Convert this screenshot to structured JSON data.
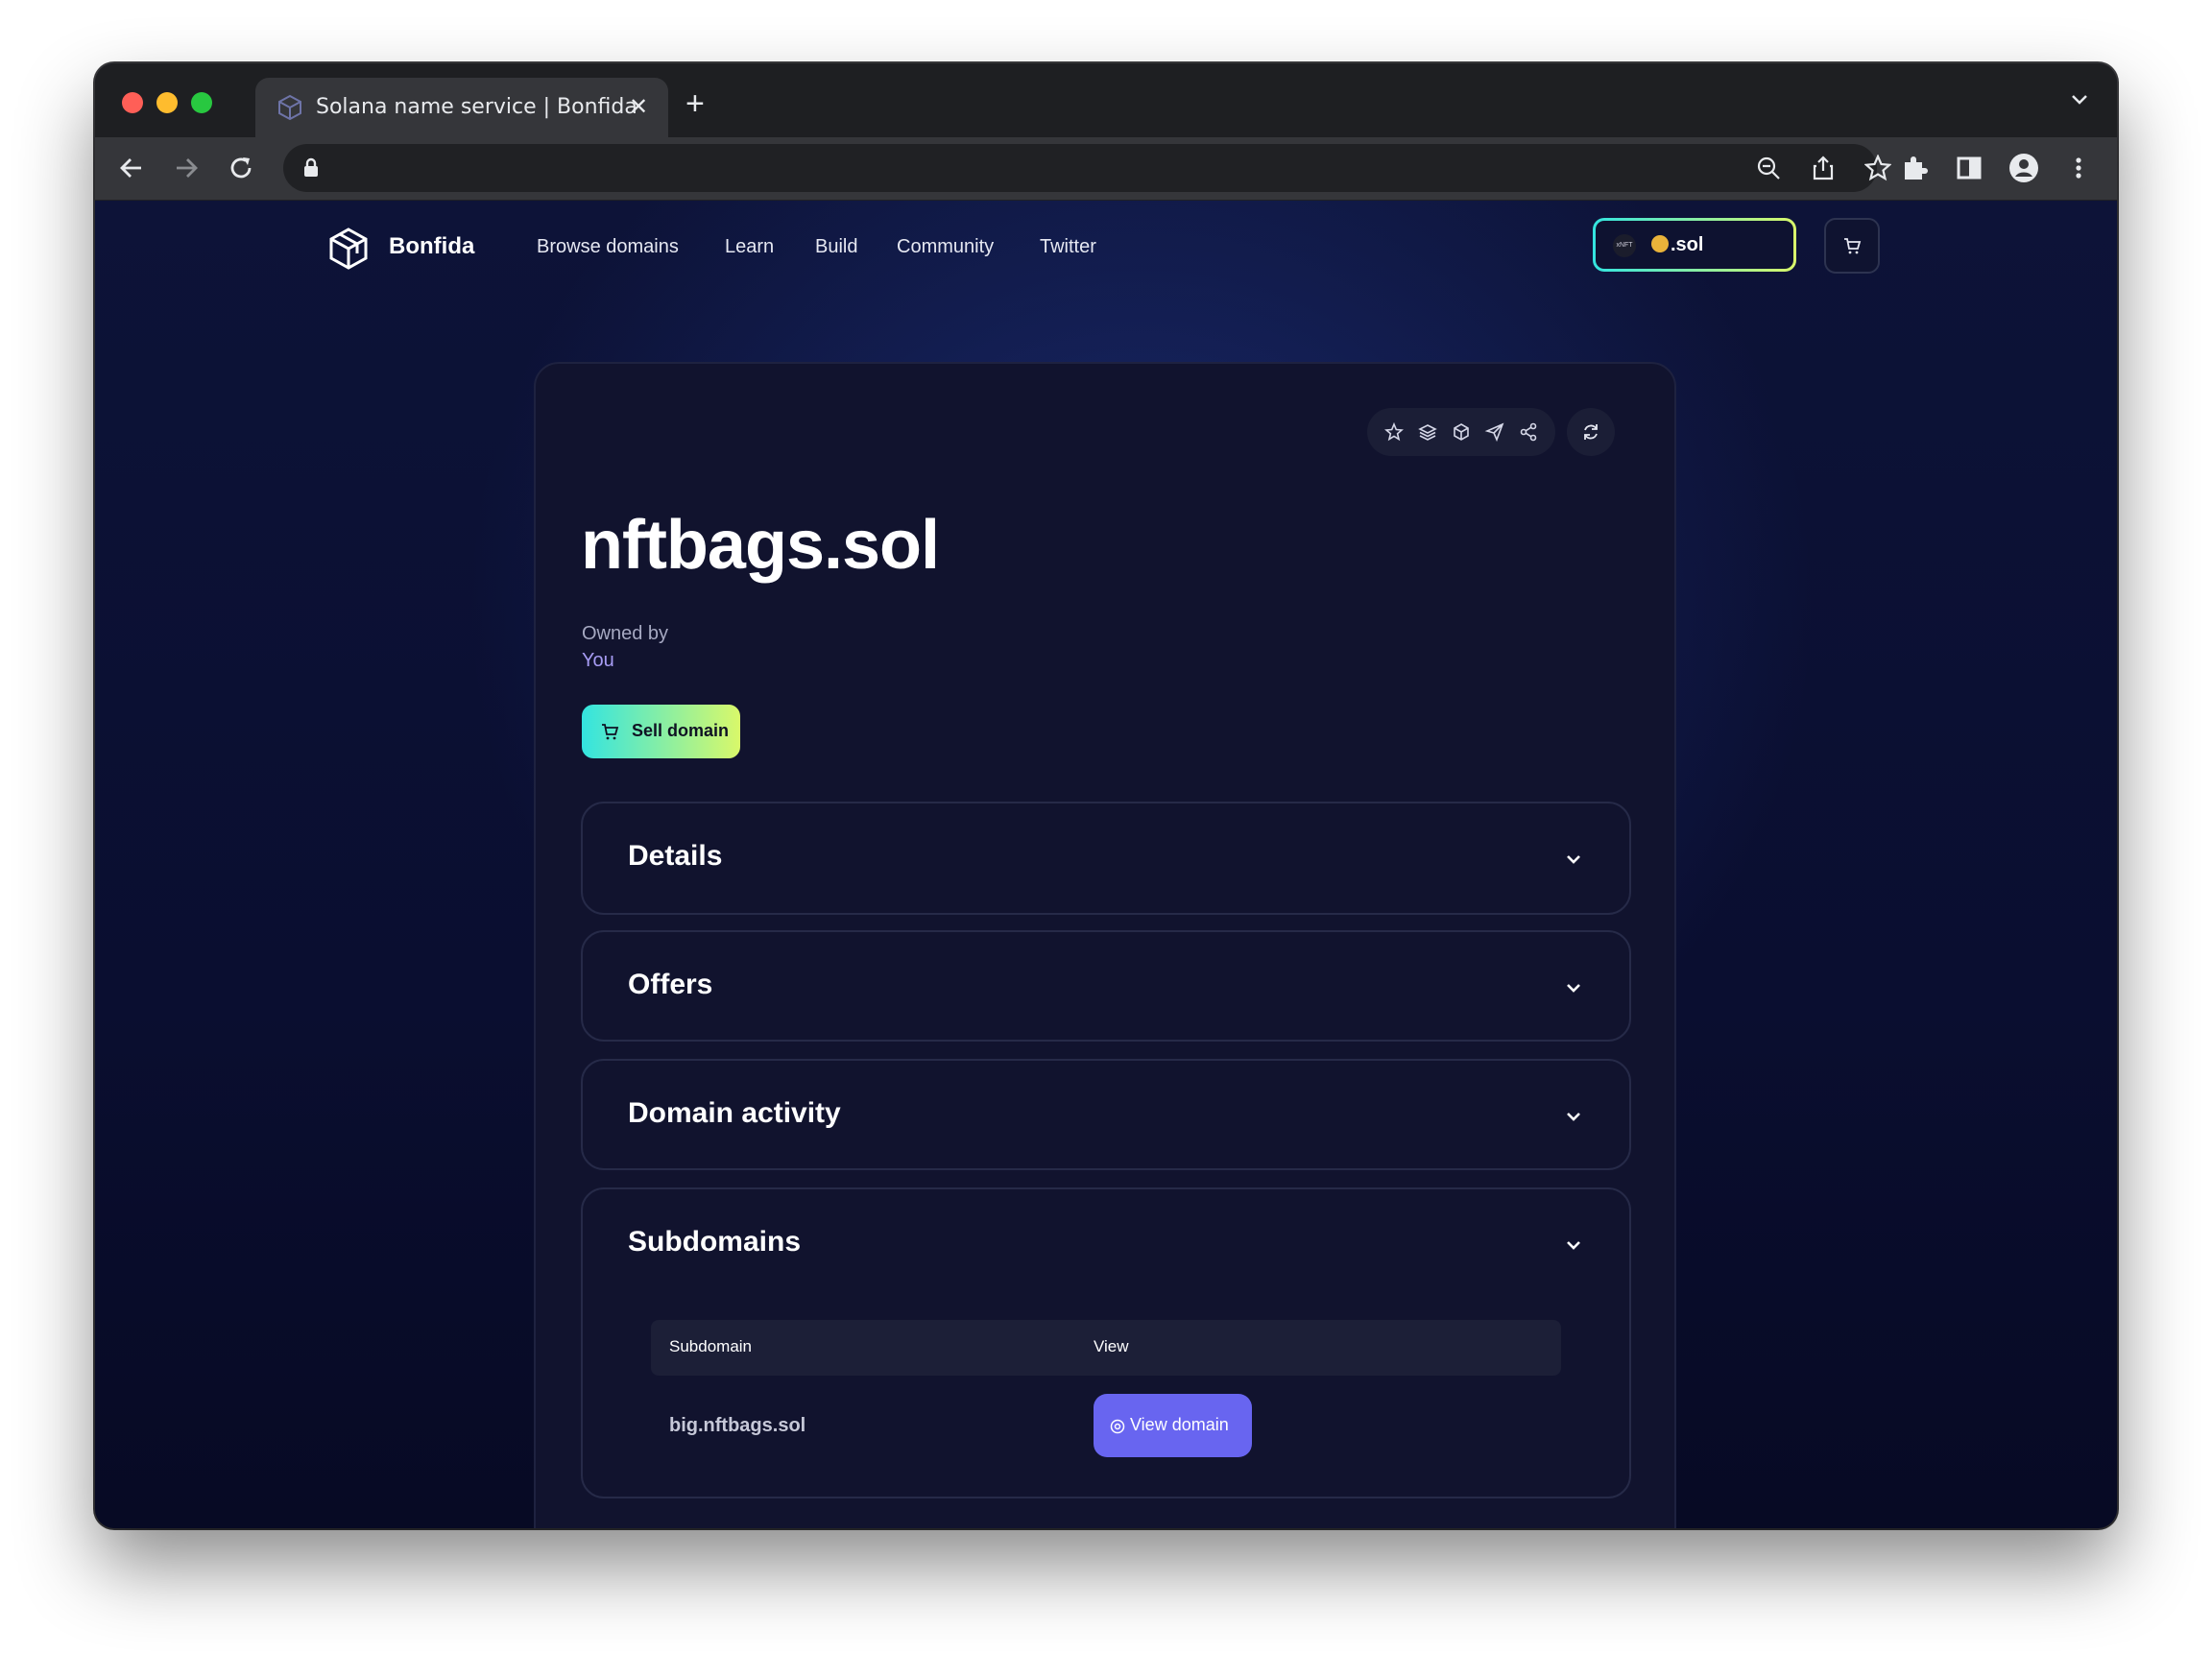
{
  "browser": {
    "tab_title": "Solana name service | Bonfida",
    "tab_close": "✕",
    "new_tab": "+"
  },
  "nav": {
    "brand": "Bonfida",
    "links": [
      "Browse domains",
      "Learn",
      "Build",
      "Community",
      "Twitter"
    ],
    "nft_badge": "xNFT",
    "sol_label": ".sol"
  },
  "domain": {
    "name": "nftbags.sol",
    "owned_by_label": "Owned by",
    "owner": "You",
    "sell_button": "Sell domain"
  },
  "sections": [
    {
      "title": "Details"
    },
    {
      "title": "Offers"
    },
    {
      "title": "Domain activity"
    },
    {
      "title": "Subdomains"
    }
  ],
  "subdomains": {
    "columns": [
      "Subdomain",
      "View"
    ],
    "rows": [
      {
        "subdomain": "big.nftbags.sol",
        "view_label": "View domain"
      }
    ]
  },
  "colors": {
    "accent_gradient_start": "#33e4e0",
    "accent_gradient_end": "#d9f86a",
    "view_button": "#6865f0",
    "owner_text": "#a79cf4"
  }
}
